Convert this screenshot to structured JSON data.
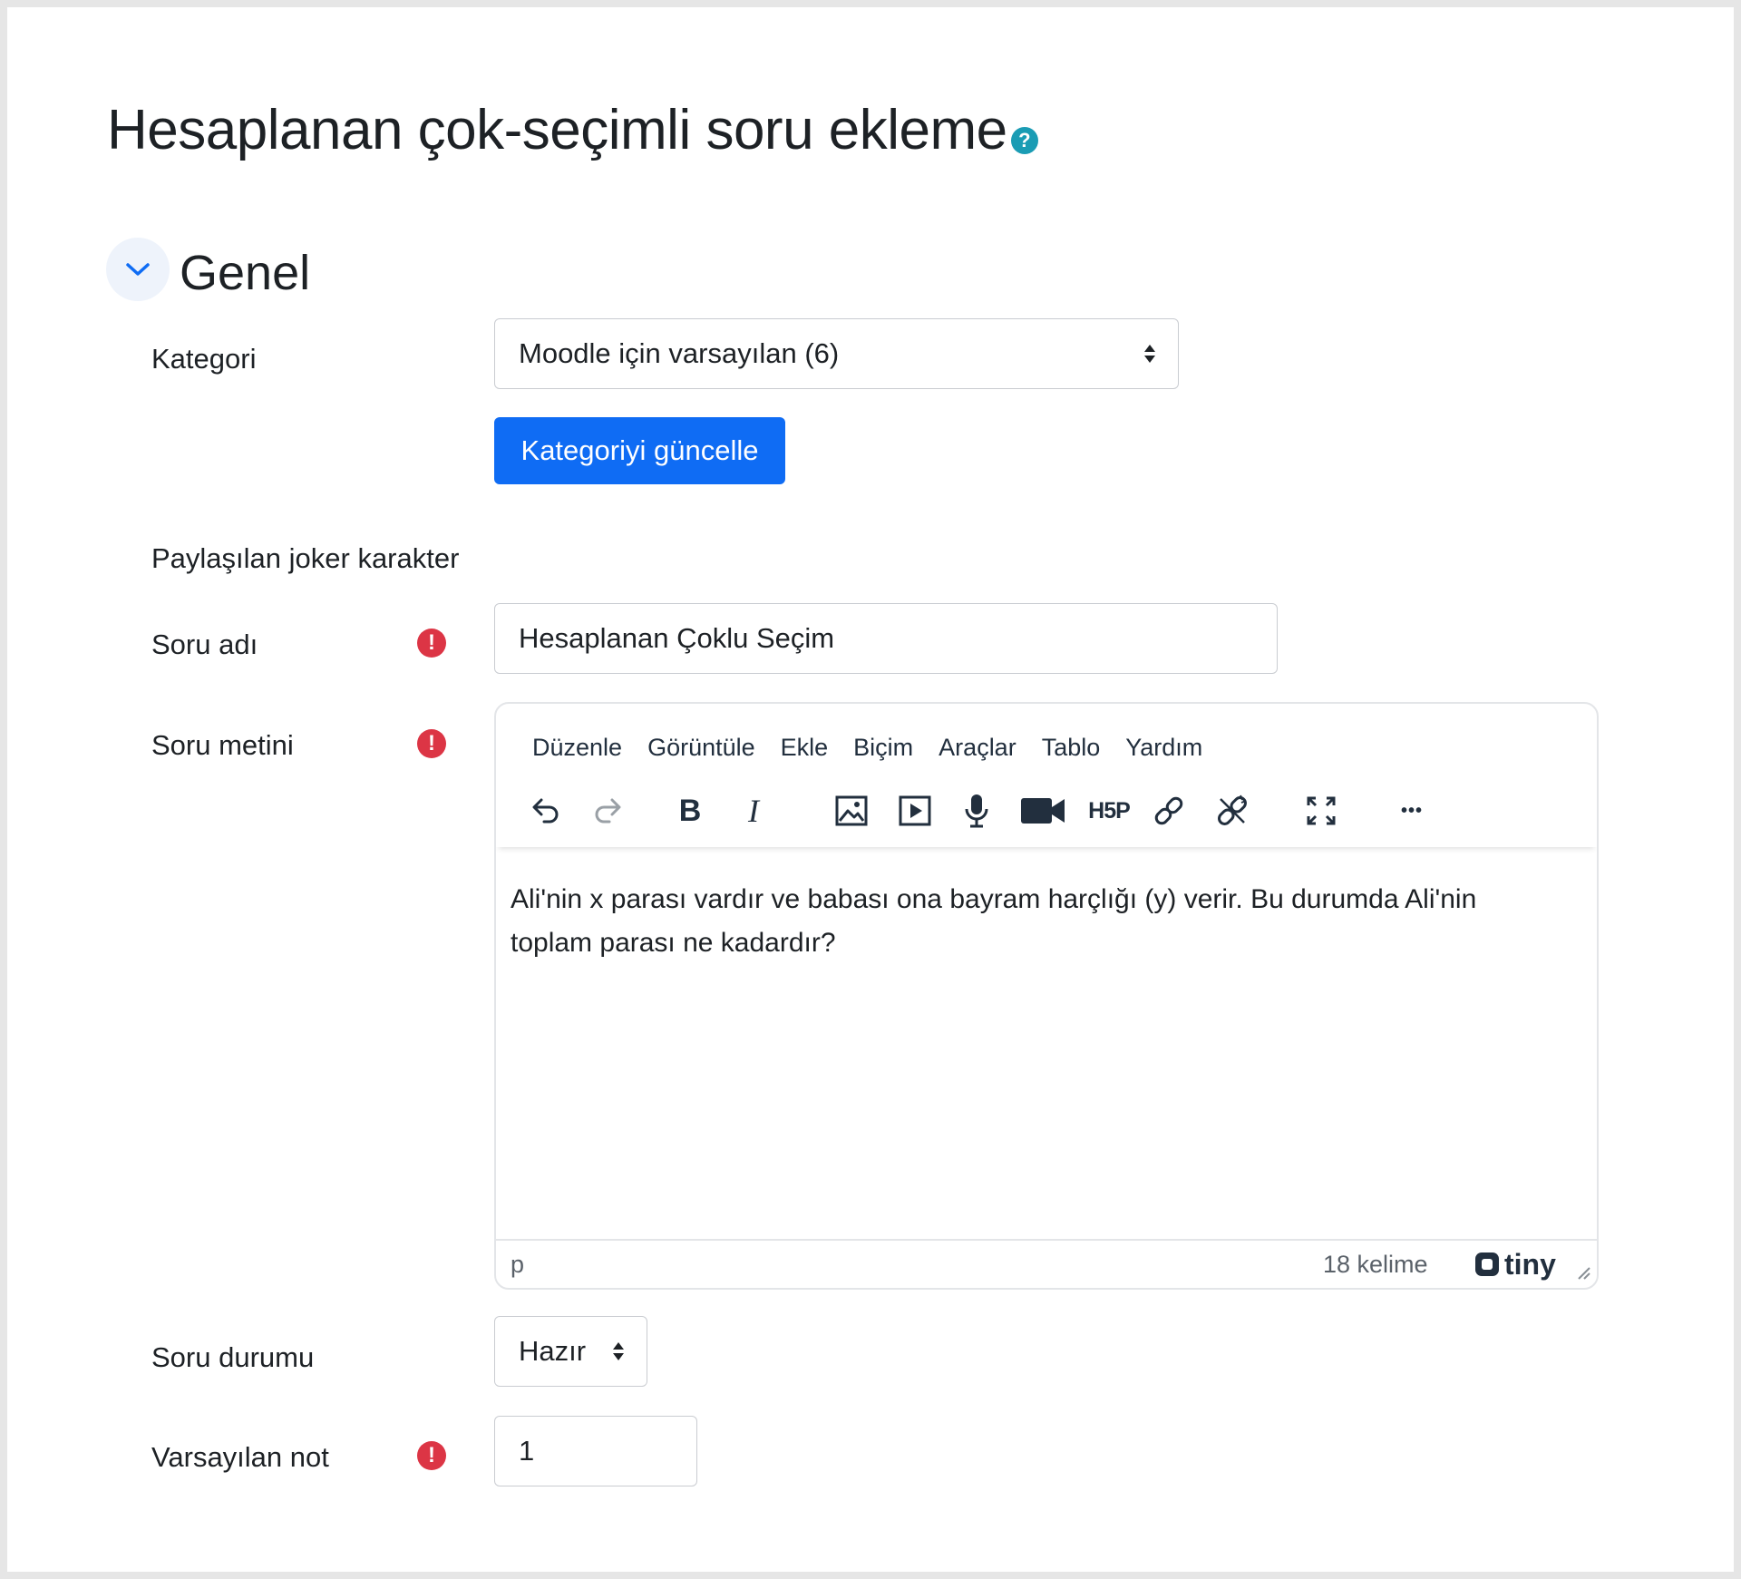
{
  "page": {
    "title": "Hesaplanan çok-seçimli soru ekleme",
    "help_icon": "help-icon"
  },
  "section": {
    "title": "Genel",
    "toggle_icon": "chevron-down-icon"
  },
  "form": {
    "kategori": {
      "label": "Kategori",
      "value": "Moodle için varsayılan (6)",
      "button": "Kategoriyi güncelle"
    },
    "joker": {
      "label": "Paylaşılan joker karakter"
    },
    "soru_adi": {
      "label": "Soru adı",
      "value": "Hesaplanan Çoklu Seçim",
      "required_icon": "!"
    },
    "soru_metni": {
      "label": "Soru metini",
      "required_icon": "!"
    },
    "soru_durumu": {
      "label": "Soru durumu",
      "value": "Hazır"
    },
    "varsayilan_not": {
      "label": "Varsayılan not",
      "value": "1",
      "required_icon": "!"
    }
  },
  "editor": {
    "menu": [
      "Düzenle",
      "Görüntüle",
      "Ekle",
      "Biçim",
      "Araçlar",
      "Tablo",
      "Yardım"
    ],
    "toolbar": {
      "undo": "undo-icon",
      "redo": "redo-icon",
      "bold": "B",
      "italic": "I",
      "image": "image-icon",
      "media": "media-icon",
      "audio": "microphone-icon",
      "video": "video-camera-icon",
      "h5p": "H5P",
      "link": "link-icon",
      "unlink": "unlink-icon",
      "fullscreen": "fullscreen-icon",
      "more": "•••"
    },
    "content": "Ali'nin x parası vardır ve babası ona bayram harçlığı (y) verir. Bu durumda Ali'nin toplam parası ne kadardır?",
    "status": {
      "path": "p",
      "word_count": "18 kelime",
      "brand": "tiny"
    }
  },
  "colors": {
    "primary": "#0f6cf4",
    "required": "#dc3545",
    "help": "#1a9cb4"
  }
}
